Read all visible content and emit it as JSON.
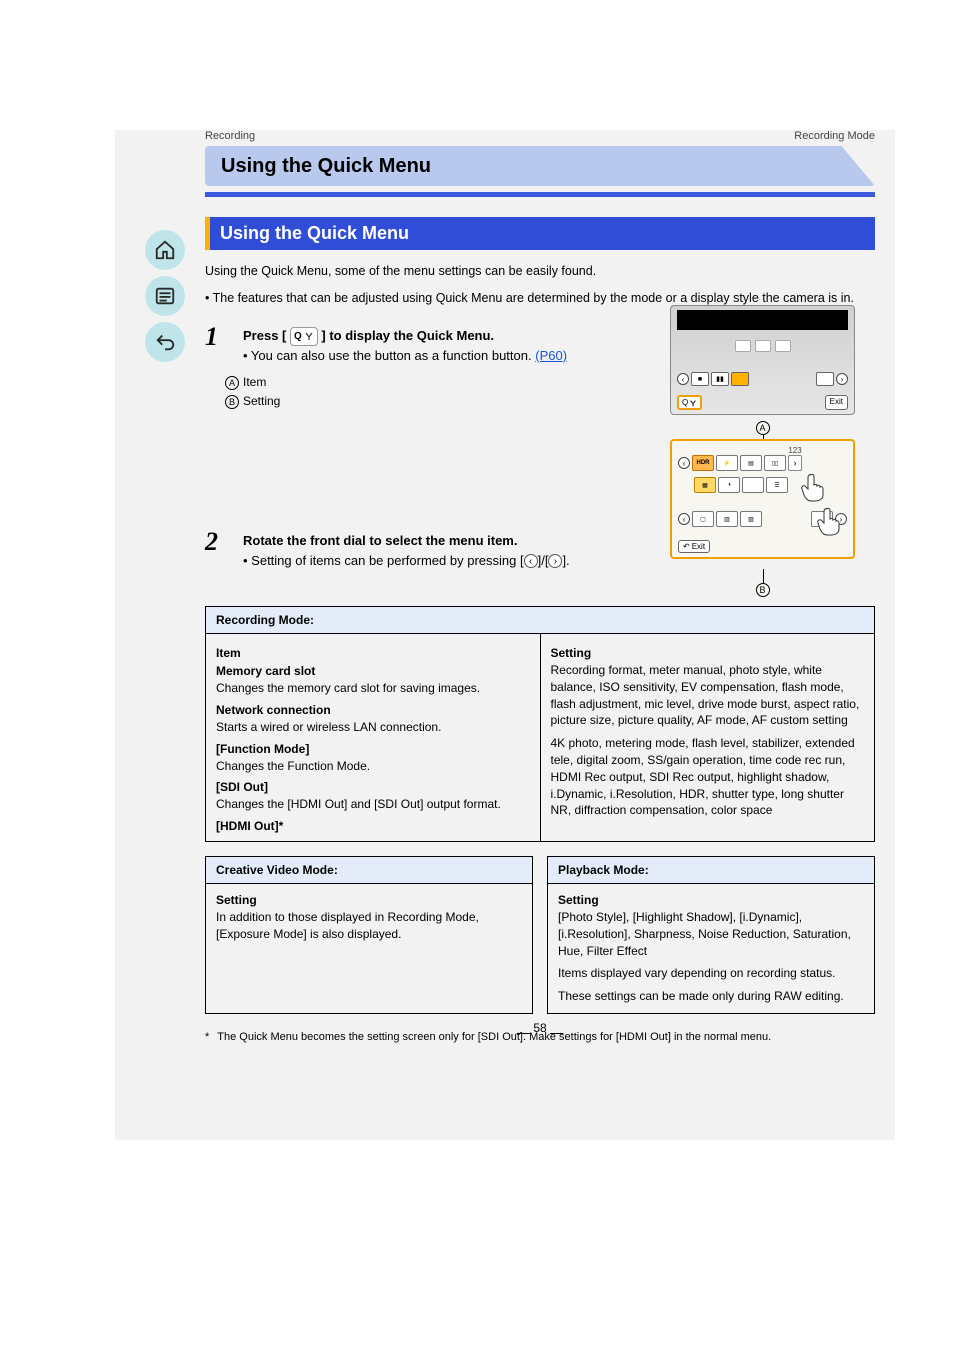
{
  "header": {
    "breadcrumb_left": "Recording",
    "breadcrumb_right": "Recording Mode",
    "title": "Using the Quick Menu"
  },
  "section_bar": "Using the Quick Menu",
  "intro": "Using the Quick Menu, some of the menu settings can be easily found.",
  "note": "• The features that can be adjusted using Quick Menu are determined by the mode or a display style the camera is in.",
  "step1": {
    "num": "1",
    "line1_before": "Press [",
    "line1_after": "] to display the Quick Menu.",
    "sub": "• You can also use the button as a function button.",
    "sub_link": "(P60)"
  },
  "callouts": {
    "A": "Item",
    "B": "Setting"
  },
  "step2": {
    "num": "2",
    "line": "Rotate the front dial to select the menu item.",
    "bullet_before": "• Setting of items can be performed by pressing [",
    "bullet_after": "]/[",
    "bullet_end": "]."
  },
  "table": {
    "rec_mode": {
      "header": "Recording Mode:",
      "col_left_head": "Item",
      "items": [
        {
          "head": "Memory card slot",
          "body": "Changes the memory card slot for saving images."
        },
        {
          "head": "Network connection",
          "body": "Starts a wired or wireless LAN connection."
        },
        {
          "head": "[Function Mode]",
          "body": "Changes the Function Mode."
        },
        {
          "head": "[SDI Out]",
          "body": "Changes the [HDMI Out] and [SDI Out] output format."
        },
        {
          "head": "[HDMI Out]*",
          "body": ""
        }
      ],
      "col_right_head": "Setting",
      "settings": [
        "Recording format, meter manual, photo style, white balance, ISO sensitivity, EV compensation, flash mode, flash adjustment, mic level, drive mode burst, aspect ratio, picture size, picture quality, AF mode, AF custom setting",
        "4K photo, metering mode, flash level, stabilizer, extended tele, digital zoom, SS/gain operation, time code rec run, HDMI Rec output, SDI Rec output, highlight shadow, i.Dynamic, i.Resolution, HDR, shutter type, long shutter NR, diffraction compensation, color space"
      ]
    },
    "creative_video": {
      "header": "Creative Video Mode:",
      "setting_label": "Setting",
      "body": "In addition to those displayed in Recording Mode, [Exposure Mode] is also displayed."
    },
    "playback_mode": {
      "header": "Playback Mode:",
      "setting_label": "Setting",
      "body1": "[Photo Style], [Highlight Shadow], [i.Dynamic], [i.Resolution], Sharpness, Noise Reduction, Saturation, Hue, Filter Effect",
      "body2": "Items displayed vary depending on recording status.",
      "body3": "These settings can be made only during RAW editing."
    }
  },
  "footnote": "The Quick Menu becomes the setting screen only for [SDI Out]. Make settings for [HDMI Out] in the normal menu.",
  "lcd": {
    "exit": "Exit",
    "exit2": "Exit",
    "nums": "123"
  },
  "page_number": "58"
}
